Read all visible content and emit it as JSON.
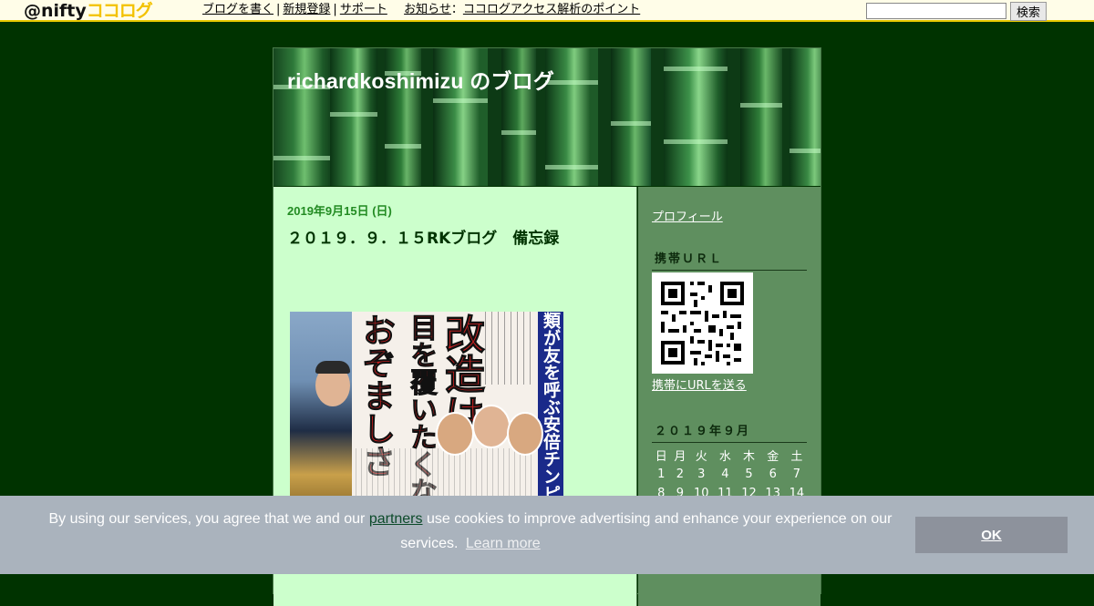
{
  "header": {
    "logo_prefix": "@nifty",
    "logo_suffix": "ココログ",
    "nav": {
      "write_blog": "ブログを書く",
      "sep1": "|",
      "register": "新規登録",
      "sep2": "|",
      "support": "サポート",
      "notice_label": "お知らせ",
      "notice_colon": "：",
      "notice_link": "ココログアクセス解析のポイント"
    },
    "search": {
      "value": "",
      "button_label": "検索"
    }
  },
  "blog": {
    "title": "richardkoshimizu のブログ"
  },
  "post": {
    "date": "2019年9月15日 (日)",
    "title": "２０１９．９．１５RKブログ　備忘録",
    "image": {
      "headline_1": "改造は",
      "headline_2": "目を覆いたくなる",
      "headline_3": "おぞましさ",
      "side_headline": "類が友を呼ぶ安倍チンピラ内閣"
    }
  },
  "sidebar": {
    "profile_link": "プロフィール",
    "mobile_heading": "携帯ＵＲＬ",
    "send_link": "携帯にURLを送る",
    "calendar_heading": "２０１９年９月",
    "weekdays": [
      "日",
      "月",
      "火",
      "水",
      "木",
      "金",
      "土"
    ],
    "weeks": [
      [
        "1",
        "2",
        "3",
        "4",
        "5",
        "6",
        "7"
      ],
      [
        "8",
        "9",
        "10",
        "11",
        "12",
        "13",
        "14"
      ]
    ]
  },
  "cookie": {
    "text_before": "By using our services, you agree that we and our",
    "partners_link": "partners",
    "text_after": "use cookies to improve advertising and enhance your experience on our services.",
    "learn_more": "Learn more",
    "ok_label": "OK"
  },
  "colors": {
    "page_bg": "#003300",
    "content_bg": "#ccffcc",
    "sidebar_bg": "#5f8f5f",
    "date_green": "#228b22",
    "cookie_bg": "#aab3bd",
    "ok_bg": "#8d929c"
  }
}
